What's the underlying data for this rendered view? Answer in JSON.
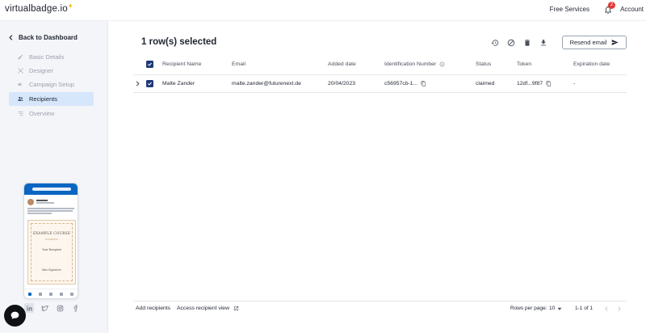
{
  "app": {
    "logo_text": "virtualbadge.io",
    "free_services_label": "Free Services",
    "notification_count": "2",
    "account_label": "Account"
  },
  "sidebar": {
    "back_label": "Back to Dashboard",
    "items": [
      {
        "label": "Basic Details",
        "icon": "edit-icon",
        "active": false
      },
      {
        "label": "Designer",
        "icon": "designer-icon",
        "active": false
      },
      {
        "label": "Campaign Setup",
        "icon": "campaign-icon",
        "active": false
      },
      {
        "label": "Recipients",
        "icon": "recipients-icon",
        "active": true
      },
      {
        "label": "Overview",
        "icon": "list-icon",
        "active": false
      }
    ],
    "preview": {
      "poster_name": "Jane Doe",
      "post_text": "I have successfully completed the course \"Example Course\". Thanks to all who supported me!",
      "certificate_title": "EXAMPLE COURSE",
      "certificate_subtitle": "Certificate",
      "recipient_placeholder": "Your Recipient",
      "signature": "Max Signature"
    },
    "socials": [
      "linkedin-icon",
      "twitter-icon",
      "instagram-icon",
      "facebook-icon"
    ]
  },
  "main": {
    "title": "1 row(s) selected",
    "actions": [
      "history-icon",
      "block-icon",
      "delete-icon",
      "download-icon"
    ],
    "resend_label": "Resend email",
    "table": {
      "headers": {
        "name": "Recipient Name",
        "email": "Email",
        "added": "Added date",
        "id": "Identification Number",
        "status": "Status",
        "token": "Token",
        "expiration": "Expiration date"
      },
      "rows": [
        {
          "name": "Malte Zander",
          "email": "malte.zander@futurenext.de",
          "added": "20/04/2023",
          "id": "c56957cb-1...",
          "status": "claimed",
          "token": "12df...9f87",
          "expiration": "-"
        }
      ]
    },
    "footer": {
      "add_recipients": "Add recipients",
      "access_view": "Access recipient view",
      "rows_per_page_label": "Rows per page:",
      "rows_per_page_value": "10",
      "range": "1-1 of 1"
    }
  },
  "colors": {
    "accent": "#1f3a78",
    "active_nav": "#d6e6fb",
    "sidebar_bg": "#f4f5f8",
    "badge": "#e53935"
  }
}
